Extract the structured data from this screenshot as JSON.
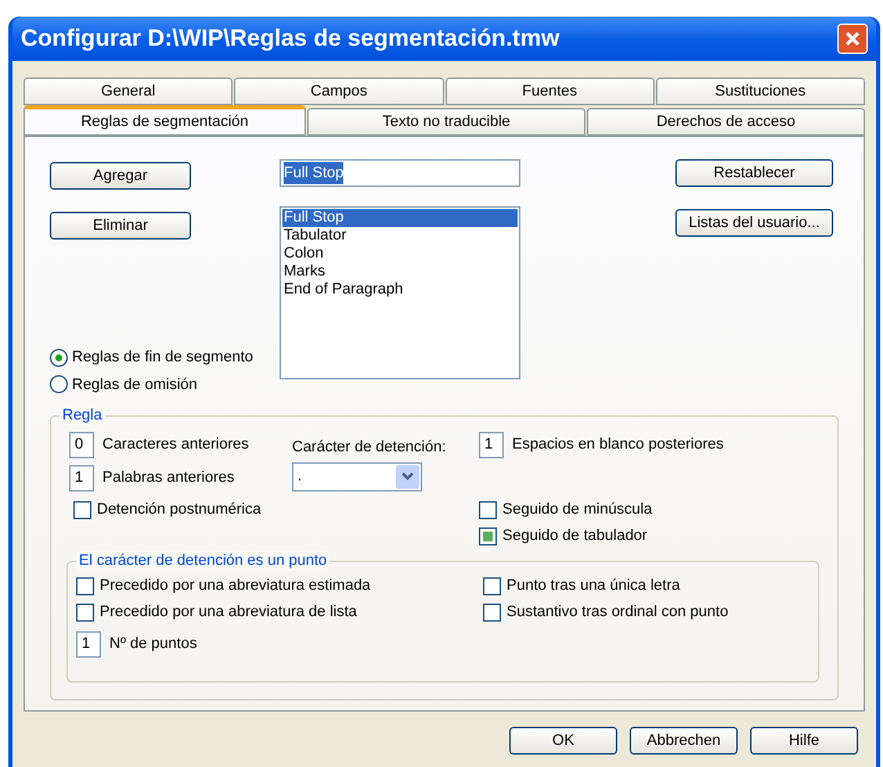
{
  "window": {
    "title": "Configurar D:\\WIP\\Reglas de segmentación.tmw"
  },
  "tab_rows": [
    {
      "tabs": [
        {
          "label": "General",
          "selected": false
        },
        {
          "label": "Campos",
          "selected": false
        },
        {
          "label": "Fuentes",
          "selected": false
        },
        {
          "label": "Sustituciones",
          "selected": false
        }
      ]
    },
    {
      "tabs": [
        {
          "label": "Reglas de segmentación",
          "selected": true
        },
        {
          "label": "Texto no traducible",
          "selected": false
        },
        {
          "label": "Derechos de acceso",
          "selected": false
        }
      ]
    }
  ],
  "left_buttons": [
    "Agregar",
    "Eliminar"
  ],
  "name_field": {
    "value": "Full Stop",
    "text_selected": true
  },
  "rules_list": [
    {
      "label": "Full Stop",
      "selected": true
    },
    {
      "label": "Tabulator",
      "selected": false
    },
    {
      "label": "Colon",
      "selected": false
    },
    {
      "label": "Marks",
      "selected": false
    },
    {
      "label": "End of Paragraph",
      "selected": false
    }
  ],
  "right_buttons": [
    "Restablecer",
    "Listas del usuario..."
  ],
  "rule_types": [
    {
      "label": "Reglas de fin de segmento",
      "selected": true
    },
    {
      "label": "Reglas de omisión",
      "selected": false
    }
  ],
  "rule_group": {
    "title": "Regla",
    "chars_before": {
      "value": "0",
      "label": "Caracteres anteriores"
    },
    "words_before": {
      "value": "1",
      "label": "Palabras anteriores"
    },
    "stop_char": {
      "label": "Carácter de detención:",
      "value": "."
    },
    "spaces_after": {
      "value": "1",
      "label": "Espacios en blanco posteriores"
    },
    "checks_left": [
      {
        "label": "Detención postnumérica",
        "checked": false
      }
    ],
    "checks_right": [
      {
        "label": "Seguido de minúscula",
        "checked": false
      },
      {
        "label": "Seguido de tabulador",
        "checked": true
      }
    ],
    "period_group": {
      "title": "El carácter de detención es un punto",
      "checks_left": [
        {
          "label": "Precedido por una abreviatura estimada",
          "checked": false
        },
        {
          "label": "Precedido por una abreviatura de lista",
          "checked": false
        }
      ],
      "checks_right": [
        {
          "label": "Punto tras una única letra",
          "checked": false
        },
        {
          "label": "Sustantivo tras ordinal con punto",
          "checked": false
        }
      ],
      "periods": {
        "value": "1",
        "label": "Nº de puntos"
      }
    }
  },
  "footer_buttons": [
    "OK",
    "Abbrechen",
    "Hilfe"
  ]
}
